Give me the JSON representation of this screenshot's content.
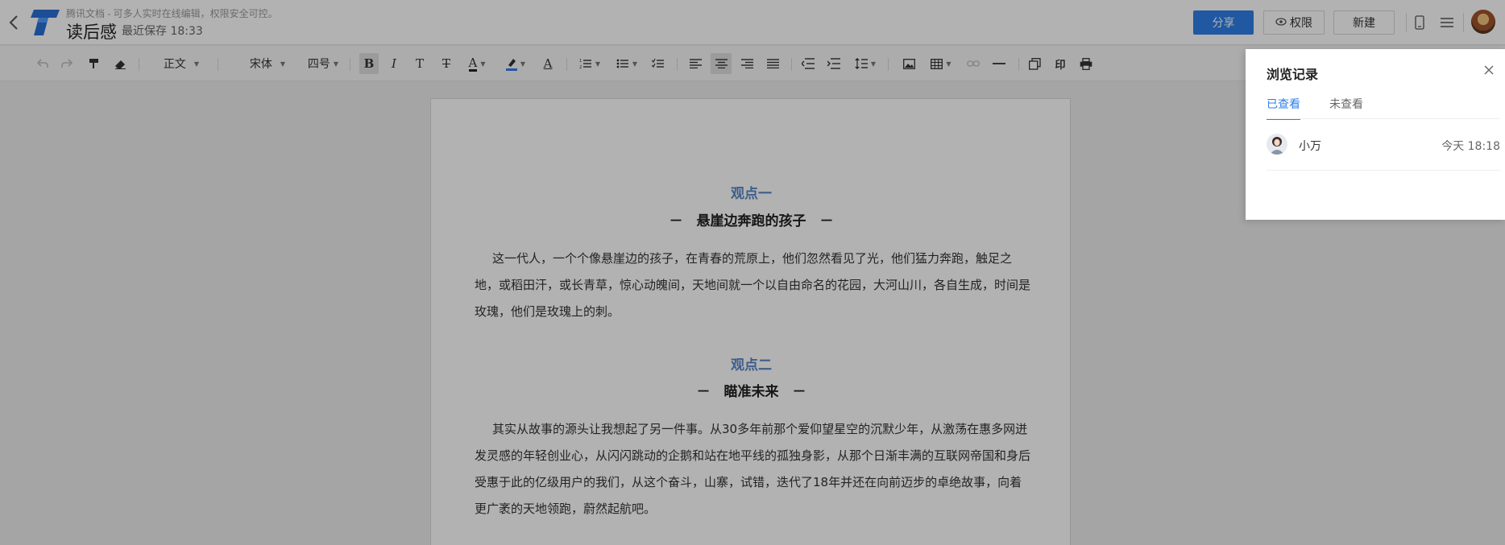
{
  "header": {
    "tagline": "腾讯文档 - 可多人实时在线编辑，权限安全可控。",
    "doc_title": "读后感",
    "save_status": "最近保存 18:33",
    "share_label": "分享",
    "permission_label": "权限",
    "new_label": "新建",
    "icons": [
      "back-arrow-icon",
      "app-logo",
      "mobile-icon",
      "menu-icon",
      "user-avatar"
    ],
    "accent_color": "#2f7fe8"
  },
  "toolbar": {
    "paragraph_style": "正文",
    "font_family": "宋体",
    "font_size": "四号",
    "bold_label": "B",
    "italic_label": "I",
    "text_t_label": "T",
    "strike_label": "T",
    "font_color_label": "A",
    "font_color": "#222222",
    "highlight_color": "#2f7fe8",
    "clear_format_label": "A",
    "seal_label": "印"
  },
  "document": {
    "sections": [
      {
        "heading": "观点一",
        "subheading": "－　悬崖边奔跑的孩子　－",
        "paragraph": "这一代人，一个个像悬崖边的孩子，在青春的荒原上，他们忽然看见了光，他们猛力奔跑，触足之地，或稻田汗，或长青草，惊心动魄间，天地间就一个以自由命名的花园，大河山川，各自生成，时间是玫瑰，他们是玫瑰上的刺。"
      },
      {
        "heading": "观点二",
        "subheading": "－　瞄准未来　－",
        "paragraph": "其实从故事的源头让我想起了另一件事。从30多年前那个爱仰望星空的沉默少年，从激荡在惠多网迸发灵感的年轻创业心，从闪闪跳动的企鹅和站在地平线的孤独身影，从那个日渐丰满的互联网帝国和身后受惠于此的亿级用户的我们，从这个奋斗，山寨，试错，迭代了18年并还在向前迈步的卓绝故事，向着更广袤的天地领跑，蔚然起航吧。"
      }
    ],
    "heading_color": "#5a87c8"
  },
  "history_panel": {
    "title": "浏览记录",
    "tabs": [
      {
        "label": "已查看",
        "active": true
      },
      {
        "label": "未查看",
        "active": false
      }
    ],
    "records": [
      {
        "name": "小万",
        "time": "今天 18:18"
      }
    ]
  }
}
